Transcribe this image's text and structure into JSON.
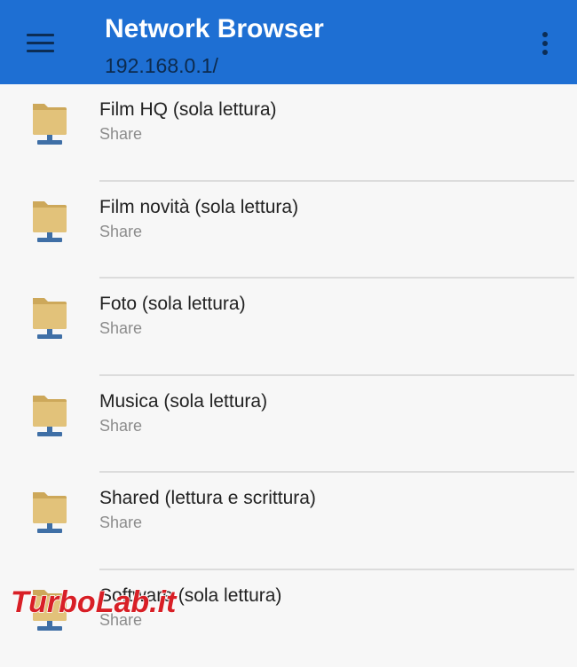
{
  "app_bar": {
    "title": "Network Browser",
    "subtitle": "192.168.0.1/",
    "menu_icon": "hamburger-menu-icon",
    "overflow_icon": "more-vert-icon",
    "color": "#1e6fd3"
  },
  "shares": [
    {
      "name": "Film HQ (sola lettura)",
      "type": "Share"
    },
    {
      "name": "Film novità (sola lettura)",
      "type": "Share"
    },
    {
      "name": "Foto (sola lettura)",
      "type": "Share"
    },
    {
      "name": "Musica (sola lettura)",
      "type": "Share"
    },
    {
      "name": "Shared (lettura e scrittura)",
      "type": "Share"
    },
    {
      "name": "Software (sola lettura)",
      "type": "Share"
    }
  ],
  "icons": {
    "share": "network-folder-icon"
  },
  "colors": {
    "folder": "#e2c27a",
    "network_stand": "#3f6fa6"
  },
  "watermark": {
    "text": "TurboLab.it"
  }
}
